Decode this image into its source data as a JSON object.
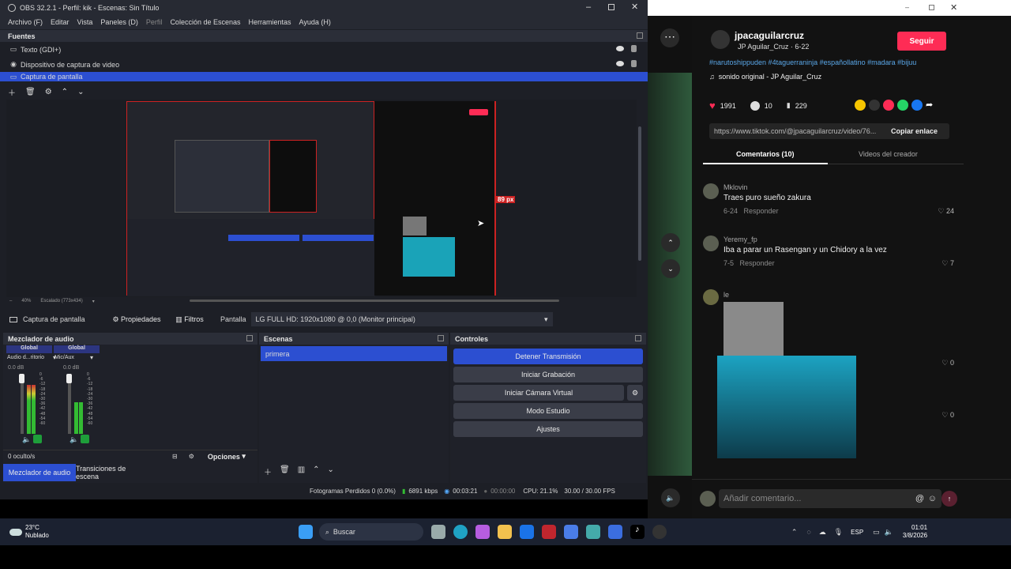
{
  "obs": {
    "title": "OBS 32.2.1 - Perfil: kik - Escenas: Sin Título",
    "menu": [
      "Archivo (F)",
      "Editar",
      "Vista",
      "Paneles (D)",
      "Perfil",
      "Colección de Escenas",
      "Herramientas",
      "Ayuda (H)"
    ],
    "sources_title": "Fuentes",
    "sources": [
      {
        "label": "Texto (GDI+)",
        "icon": "text-icon"
      },
      {
        "label": "Dispositivo de captura de video",
        "icon": "camera-icon"
      },
      {
        "label": "Captura de pantalla",
        "icon": "monitor-icon"
      }
    ],
    "preview": {
      "zoom": "40%",
      "scale": "Escalado (773x434)",
      "px_badge": "89 px"
    },
    "props_bar": {
      "source": "Captura de pantalla",
      "properties": "Propiedades",
      "filters": "Filtros",
      "display_label": "Pantalla",
      "display_value": "LG FULL HD: 1920x1080 @ 0,0 (Monitor principal)"
    },
    "audio": {
      "title": "Mezclador de audio",
      "channels": [
        {
          "group": "Global",
          "name": "Audio d...ritorio",
          "db": "0.0 dB"
        },
        {
          "group": "Global",
          "name": "Mic/Aux",
          "db": "0.0 dB"
        }
      ],
      "scale": [
        "0",
        "-6",
        "-12",
        "-18",
        "-24",
        "-30",
        "-36",
        "-42",
        "-48",
        "-54",
        "-60"
      ],
      "hidden": "0 oculto/s",
      "options": "Opciones",
      "tab_mixer": "Mezclador de audio",
      "tab_transitions": "Transiciones de escena"
    },
    "scenes": {
      "title": "Escenas",
      "items": [
        "primera"
      ]
    },
    "controls": {
      "title": "Controles",
      "stop_stream": "Detener Transmisión",
      "start_record": "Iniciar Grabación",
      "start_vcam": "Iniciar Cámara Virtual",
      "studio": "Modo Estudio",
      "settings": "Ajustes"
    },
    "status": {
      "dropped": "Fotogramas Perdidos 0 (0.0%)",
      "bitrate": "6891 kbps",
      "stream_time": "00:03:21",
      "rec_time": "00:00:00",
      "cpu": "CPU: 21.1%",
      "fps": "30.00 / 30.00 FPS"
    }
  },
  "tiktok": {
    "username": "jpacaguilarcruz",
    "display_name": "JP Aguilar_Cruz",
    "date": "6-22",
    "follow": "Seguir",
    "hashtags": "#narutoshippuden #4taguerraninja #españollatino #madara #bijuu",
    "sound": "sonido original - JP Aguilar_Cruz",
    "likes": "1991",
    "comments_count": "10",
    "saves": "229",
    "url": "https://www.tiktok.com/@jpacaguilarcruz/video/76...",
    "copy_link": "Copiar enlace",
    "tab_comments": "Comentarios (10)",
    "tab_videos": "Videos del creador",
    "comments": [
      {
        "user": "Mklovin",
        "text": "Traes puro sueño zakura",
        "date": "6-24",
        "reply": "Responder",
        "likes": "24"
      },
      {
        "user": "Yeremy_fp",
        "text": "Iba a parar un Rasengan y un Chidory a la vez",
        "date": "7-5",
        "reply": "Responder",
        "likes": "7"
      },
      {
        "user": "le",
        "likes_a": "0",
        "likes_b": "0"
      }
    ],
    "add_comment": "Añadir comentario..."
  },
  "taskbar": {
    "temp": "23°C",
    "weather": "Nublado",
    "search": "Buscar",
    "lang": "ESP",
    "time": "01:01",
    "date": "3/8/2026"
  },
  "colors": {
    "obs_bg": "#1d1f26",
    "accent": "#2c4fd1",
    "tiktok_red": "#fe2c55",
    "tiktok_bg": "#121212"
  }
}
